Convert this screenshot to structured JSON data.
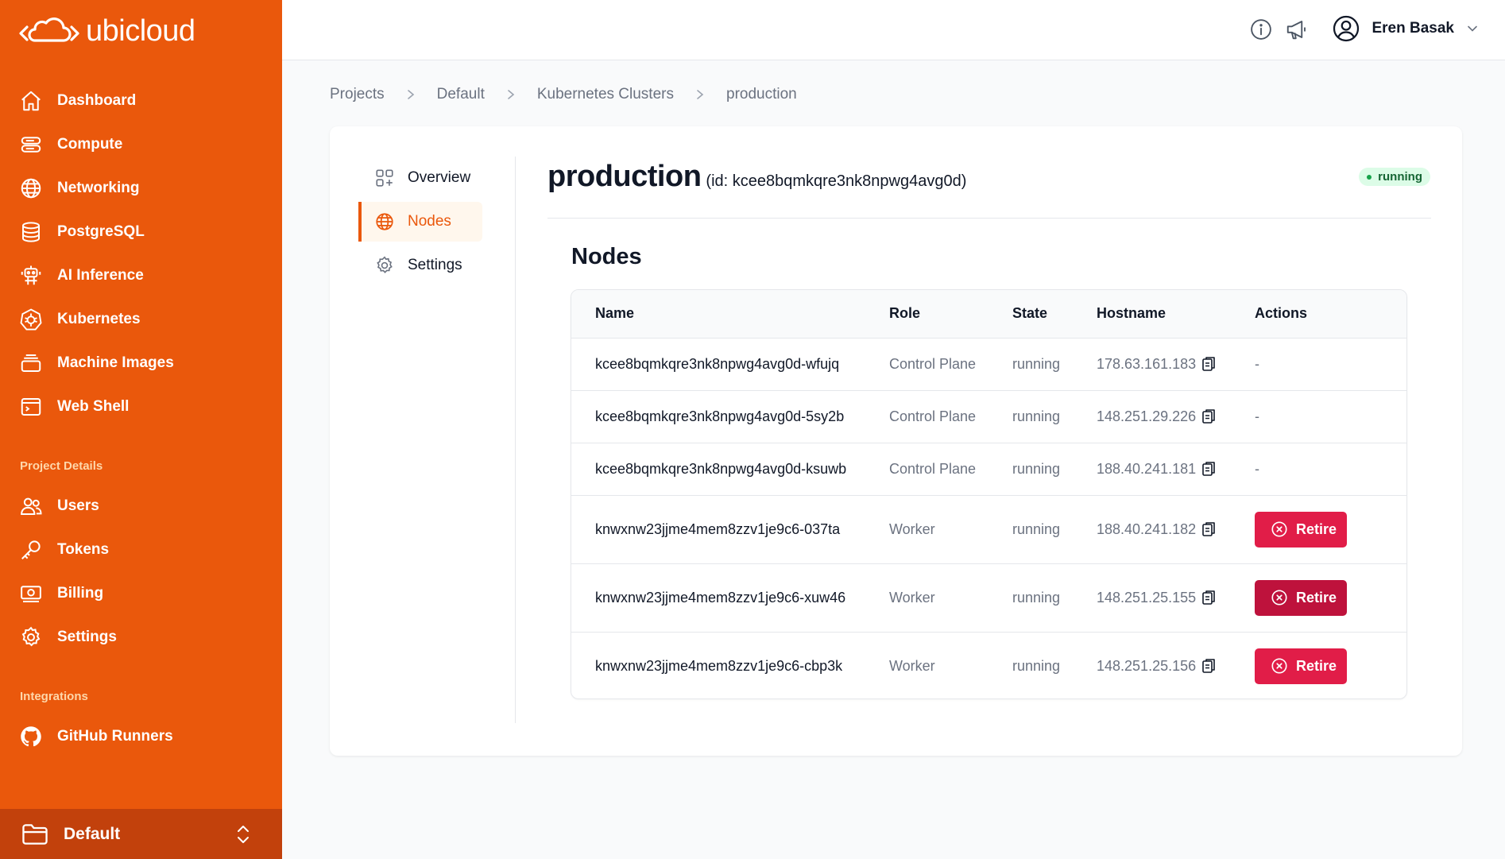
{
  "brand": {
    "name": "ubicloud"
  },
  "sidebar": {
    "items": [
      {
        "label": "Dashboard",
        "icon": "home-icon"
      },
      {
        "label": "Compute",
        "icon": "server-icon"
      },
      {
        "label": "Networking",
        "icon": "globe-icon"
      },
      {
        "label": "PostgreSQL",
        "icon": "database-icon"
      },
      {
        "label": "AI Inference",
        "icon": "robot-icon"
      },
      {
        "label": "Kubernetes",
        "icon": "kubernetes-icon"
      },
      {
        "label": "Machine Images",
        "icon": "stack-icon"
      },
      {
        "label": "Web Shell",
        "icon": "terminal-icon"
      }
    ],
    "project_section_label": "Project Details",
    "project_items": [
      {
        "label": "Users",
        "icon": "users-icon"
      },
      {
        "label": "Tokens",
        "icon": "key-icon"
      },
      {
        "label": "Billing",
        "icon": "banknote-icon"
      },
      {
        "label": "Settings",
        "icon": "gear-icon"
      }
    ],
    "integrations_section_label": "Integrations",
    "integration_items": [
      {
        "label": "GitHub Runners",
        "icon": "github-icon"
      }
    ],
    "project_switcher": {
      "label": "Default"
    }
  },
  "topbar": {
    "user_name": "Eren Basak"
  },
  "breadcrumb": [
    "Projects",
    "Default",
    "Kubernetes Clusters",
    "production"
  ],
  "subnav": {
    "items": [
      {
        "label": "Overview",
        "icon": "grid-plus-icon"
      },
      {
        "label": "Nodes",
        "icon": "globe-icon",
        "active": true
      },
      {
        "label": "Settings",
        "icon": "gear-icon"
      }
    ]
  },
  "cluster": {
    "name": "production",
    "id_text": "(id: kcee8bqmkqre3nk8npwg4avg0d)",
    "status": "running"
  },
  "nodes_section": {
    "title": "Nodes",
    "columns": [
      "Name",
      "Role",
      "State",
      "Hostname",
      "Actions"
    ],
    "rows": [
      {
        "name": "kcee8bqmkqre3nk8npwg4avg0d-wfujq",
        "role": "Control Plane",
        "state": "running",
        "hostname": "178.63.161.183",
        "action": "-"
      },
      {
        "name": "kcee8bqmkqre3nk8npwg4avg0d-5sy2b",
        "role": "Control Plane",
        "state": "running",
        "hostname": "148.251.29.226",
        "action": "-"
      },
      {
        "name": "kcee8bqmkqre3nk8npwg4avg0d-ksuwb",
        "role": "Control Plane",
        "state": "running",
        "hostname": "188.40.241.181",
        "action": "-"
      },
      {
        "name": "knwxnw23jjme4mem8zzv1je9c6-037ta",
        "role": "Worker",
        "state": "running",
        "hostname": "188.40.241.182",
        "action": "Retire"
      },
      {
        "name": "knwxnw23jjme4mem8zzv1je9c6-xuw46",
        "role": "Worker",
        "state": "running",
        "hostname": "148.251.25.155",
        "action": "Retire"
      },
      {
        "name": "knwxnw23jjme4mem8zzv1je9c6-cbp3k",
        "role": "Worker",
        "state": "running",
        "hostname": "148.251.25.156",
        "action": "Retire"
      }
    ]
  },
  "colors": {
    "sidebar_bg": "#ea580c",
    "switcher_bg": "#c2410c",
    "retire_bg": "#e11d48",
    "retire_hover_bg": "#be123c",
    "status_bg": "#dcfce7"
  }
}
